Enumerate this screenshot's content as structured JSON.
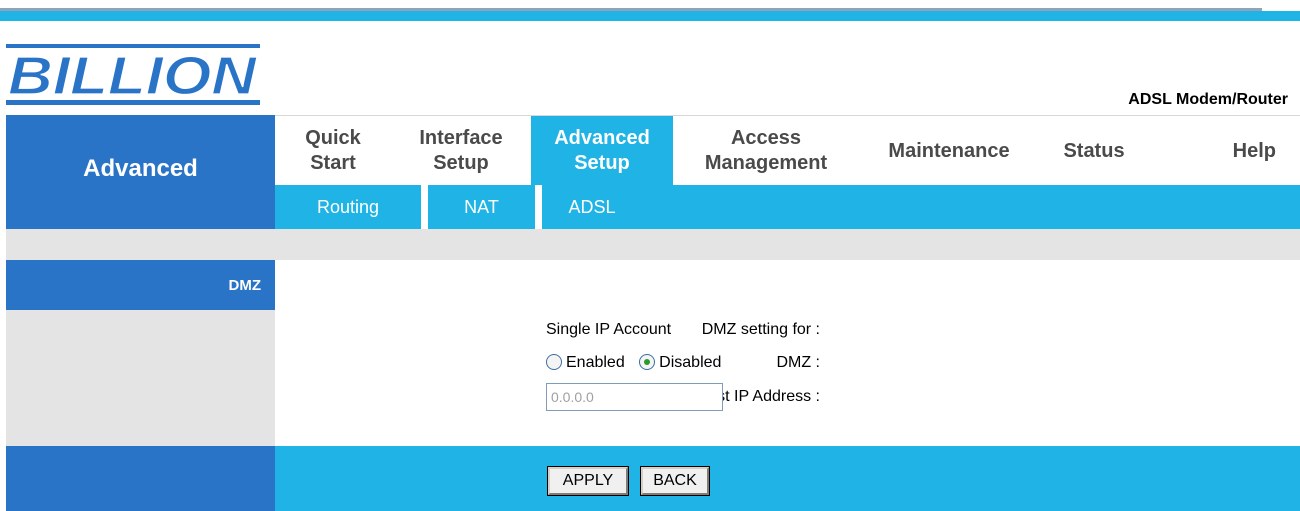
{
  "brand": {
    "logo_text": "BILLION",
    "product": "ADSL Modem/Router"
  },
  "section": {
    "title": "Advanced"
  },
  "menu": {
    "items": [
      {
        "line1": "Quick",
        "line2": "Start"
      },
      {
        "line1": "Interface",
        "line2": "Setup"
      },
      {
        "line1": "Advanced",
        "line2": "Setup"
      },
      {
        "line1": "Access",
        "line2": "Management"
      },
      {
        "line1": "Maintenance",
        "line2": ""
      },
      {
        "line1": "Status",
        "line2": ""
      },
      {
        "line1": "Help",
        "line2": ""
      }
    ],
    "active": "Advanced Setup"
  },
  "submenu": {
    "items": [
      "Routing",
      "NAT",
      "ADSL"
    ]
  },
  "side": {
    "header": "DMZ"
  },
  "form": {
    "setting_label": "DMZ setting for :",
    "setting_value": "Single IP Account",
    "dmz_label": "DMZ :",
    "enabled_label": "Enabled",
    "disabled_label": "Disabled",
    "selected": "Disabled",
    "host_label": "DMZ Host IP Address :",
    "host_value": "0.0.0.0"
  },
  "buttons": {
    "apply": "APPLY",
    "back": "BACK"
  },
  "colors": {
    "cyan": "#1fb4e5",
    "blue": "#2a74c8",
    "gray": "#e4e4e4"
  }
}
